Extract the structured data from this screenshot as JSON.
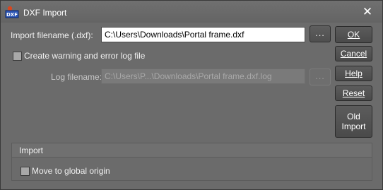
{
  "window": {
    "title": "DXF Import",
    "icon": "dxf-file-icon",
    "icon_text": "DXF",
    "close_glyph": "✕"
  },
  "import_file": {
    "label": "Import filename (.dxf):",
    "value": "C:\\Users\\Downloads\\Portal frame.dxf",
    "browse_label": "..."
  },
  "log": {
    "checkbox_label": "Create warning and error log file",
    "checked": false,
    "filename_label": "Log filename:",
    "filename_value": "C:\\Users\\P...\\Downloads\\Portal frame.dxf.log",
    "browse_label": "...",
    "enabled": false
  },
  "buttons": {
    "ok": "OK",
    "cancel": "Cancel",
    "help": "Help",
    "reset": "Reset",
    "old_import_line1": "Old",
    "old_import_line2": "Import"
  },
  "import_group": {
    "header": "Import",
    "move_to_origin_label": "Move to global origin",
    "move_to_origin_checked": false
  },
  "colors": {
    "background": "#6b6b6b",
    "button": "#4f4f4f",
    "text": "#f0f0f0"
  }
}
